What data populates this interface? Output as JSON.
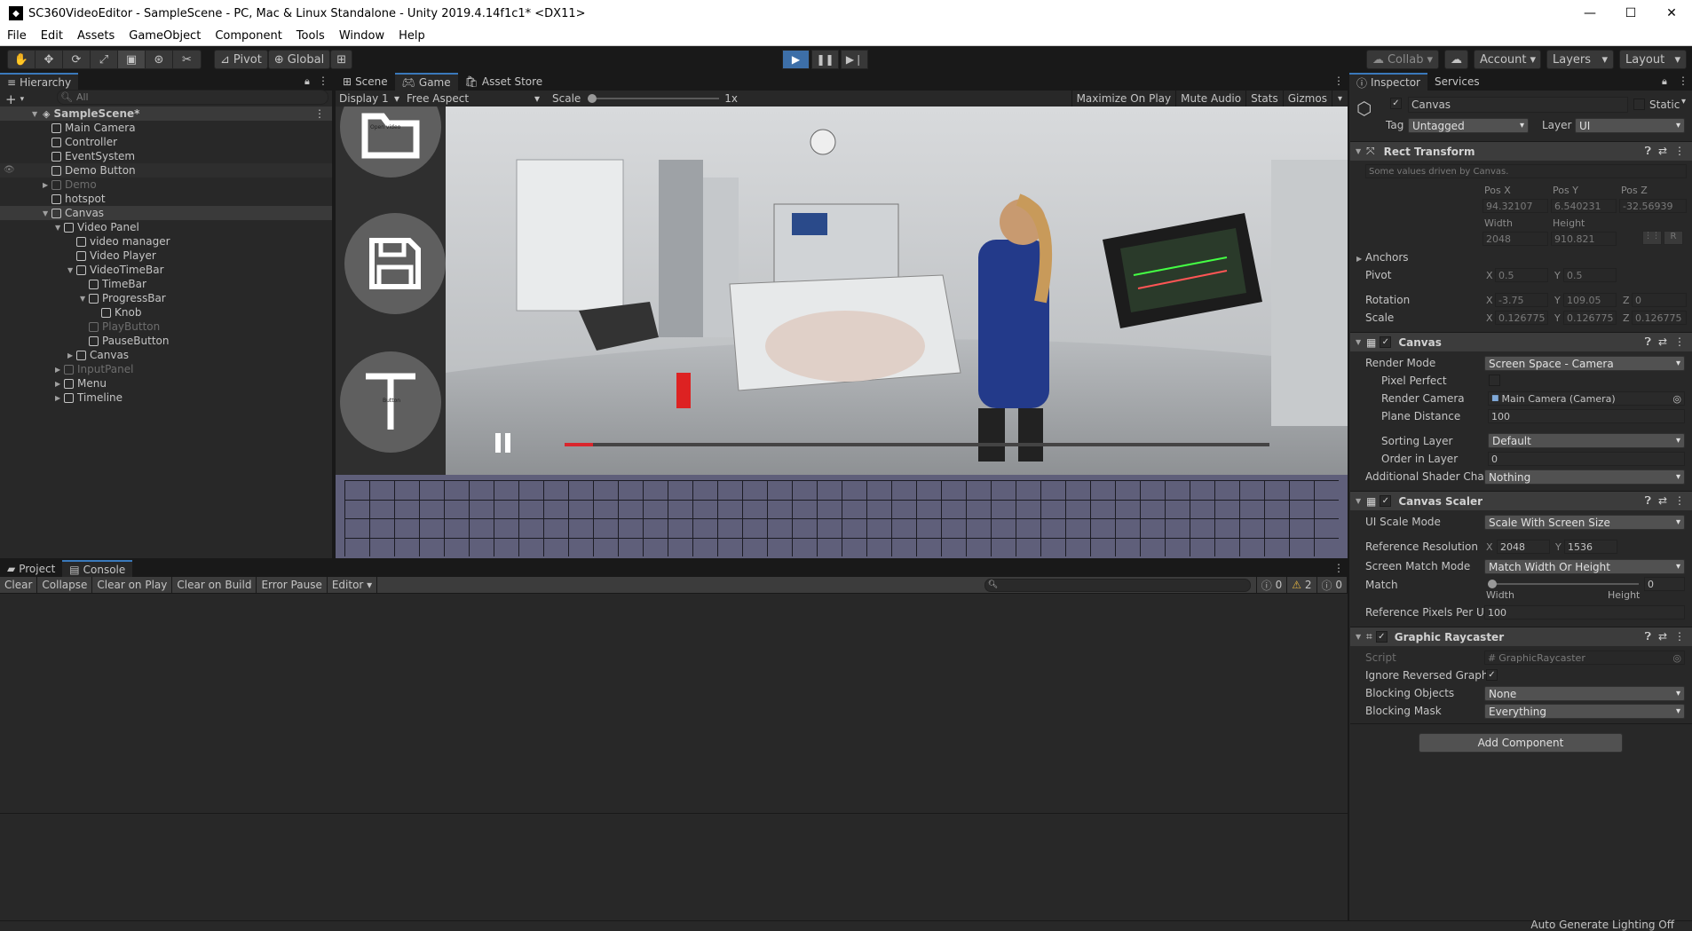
{
  "window": {
    "title": "SC360VideoEditor - SampleScene - PC, Mac & Linux Standalone - Unity 2019.4.14f1c1* <DX11>"
  },
  "menu": [
    "File",
    "Edit",
    "Assets",
    "GameObject",
    "Component",
    "Tools",
    "Window",
    "Help"
  ],
  "toolbar": {
    "pivot": "Pivot",
    "global": "Global",
    "collab": "Collab",
    "account": "Account",
    "layers": "Layers",
    "layout": "Layout"
  },
  "hierarchy": {
    "tab": "Hierarchy",
    "search_placeholder": "All",
    "scene": "SampleScene*",
    "items": [
      {
        "label": "Main Camera",
        "indent": 1,
        "arrow": "",
        "dim": false
      },
      {
        "label": "Controller",
        "indent": 1,
        "arrow": "",
        "dim": false
      },
      {
        "label": "EventSystem",
        "indent": 1,
        "arrow": "",
        "dim": false
      },
      {
        "label": "Demo Button",
        "indent": 1,
        "arrow": "",
        "dim": false
      },
      {
        "label": "Demo",
        "indent": 1,
        "arrow": "▶",
        "dim": true
      },
      {
        "label": "hotspot",
        "indent": 1,
        "arrow": "",
        "dim": false
      },
      {
        "label": "Canvas",
        "indent": 1,
        "arrow": "▼",
        "dim": false
      },
      {
        "label": "Video Panel",
        "indent": 2,
        "arrow": "▼",
        "dim": false
      },
      {
        "label": "video manager",
        "indent": 3,
        "arrow": "",
        "dim": false
      },
      {
        "label": "Video Player",
        "indent": 3,
        "arrow": "",
        "dim": false
      },
      {
        "label": "VideoTimeBar",
        "indent": 3,
        "arrow": "▼",
        "dim": false
      },
      {
        "label": "TimeBar",
        "indent": 4,
        "arrow": "",
        "dim": false
      },
      {
        "label": "ProgressBar",
        "indent": 4,
        "arrow": "▼",
        "dim": false
      },
      {
        "label": "Knob",
        "indent": 5,
        "arrow": "",
        "dim": false
      },
      {
        "label": "PlayButton",
        "indent": 4,
        "arrow": "",
        "dim": true
      },
      {
        "label": "PauseButton",
        "indent": 4,
        "arrow": "",
        "dim": false
      },
      {
        "label": "Canvas",
        "indent": 3,
        "arrow": "▶",
        "dim": false
      },
      {
        "label": "InputPanel",
        "indent": 2,
        "arrow": "▶",
        "dim": true
      },
      {
        "label": "Menu",
        "indent": 2,
        "arrow": "▶",
        "dim": false
      },
      {
        "label": "Timeline",
        "indent": 2,
        "arrow": "▶",
        "dim": false
      }
    ]
  },
  "game": {
    "tabs": [
      "Scene",
      "Game",
      "Asset Store"
    ],
    "display": "Display 1",
    "aspect": "Free Aspect",
    "scale_label": "Scale",
    "scale_value": "1x",
    "right_buttons": [
      "Maximize On Play",
      "Mute Audio",
      "Stats",
      "Gizmos"
    ],
    "open_video_text": "Open video",
    "text_button_label": "Button",
    "progress": 0.04
  },
  "console": {
    "tabs": [
      "Project",
      "Console"
    ],
    "buttons": [
      "Clear",
      "Collapse",
      "Clear on Play",
      "Clear on Build",
      "Error Pause",
      "Editor"
    ],
    "counts": {
      "info": "0",
      "warning": "2",
      "error": "0"
    }
  },
  "inspector": {
    "tabs": [
      "Inspector",
      "Services"
    ],
    "object_name": "Canvas",
    "static_label": "Static",
    "tag_label": "Tag",
    "tag_value": "Untagged",
    "layer_label": "Layer",
    "layer_value": "UI",
    "rect_transform": {
      "title": "Rect Transform",
      "note": "Some values driven by Canvas.",
      "posx_label": "Pos X",
      "posy_label": "Pos Y",
      "posz_label": "Pos Z",
      "posx": "94.32107",
      "posy": "6.540231",
      "posz": "-32.56939",
      "width_label": "Width",
      "height_label": "Height",
      "width": "2048",
      "height": "910.821",
      "anchors": "Anchors",
      "pivot_label": "Pivot",
      "pivot_x": "0.5",
      "pivot_y": "0.5",
      "rotation_label": "Rotation",
      "rot_x": "-3.75",
      "rot_y": "109.05",
      "rot_z": "0",
      "scale_label": "Scale",
      "scale_x": "0.126775",
      "scale_y": "0.126775",
      "scale_z": "0.126775",
      "r_button": "R"
    },
    "canvas": {
      "title": "Canvas",
      "render_mode_label": "Render Mode",
      "render_mode": "Screen Space - Camera",
      "pixel_perfect_label": "Pixel Perfect",
      "render_camera_label": "Render Camera",
      "render_camera": "Main Camera (Camera)",
      "plane_distance_label": "Plane Distance",
      "plane_distance": "100",
      "sorting_layer_label": "Sorting Layer",
      "sorting_layer": "Default",
      "order_label": "Order in Layer",
      "order": "0",
      "shader_label": "Additional Shader Chan",
      "shader": "Nothing"
    },
    "scaler": {
      "title": "Canvas Scaler",
      "ui_scale_label": "UI Scale Mode",
      "ui_scale": "Scale With Screen Size",
      "ref_res_label": "Reference Resolution",
      "ref_x": "2048",
      "ref_y": "1536",
      "match_mode_label": "Screen Match Mode",
      "match_mode": "Match Width Or Height",
      "match_label": "Match",
      "match_value": "0",
      "match_fraction": 0,
      "width_label": "Width",
      "height_label": "Height",
      "ppu_label": "Reference Pixels Per Ur",
      "ppu": "100"
    },
    "raycaster": {
      "title": "Graphic Raycaster",
      "script_label": "Script",
      "script": "GraphicRaycaster",
      "ignore_label": "Ignore Reversed Graphic",
      "blocking_label": "Blocking Objects",
      "blocking": "None",
      "mask_label": "Blocking Mask",
      "mask": "Everything"
    },
    "add_component": "Add Component"
  },
  "status": {
    "lighting": "Auto Generate Lighting Off"
  },
  "colors": {
    "accent": "#3a79bb",
    "play": "#3d6fa8",
    "progress": "#d9262c",
    "timeline_bg": "#5f5f7a"
  }
}
